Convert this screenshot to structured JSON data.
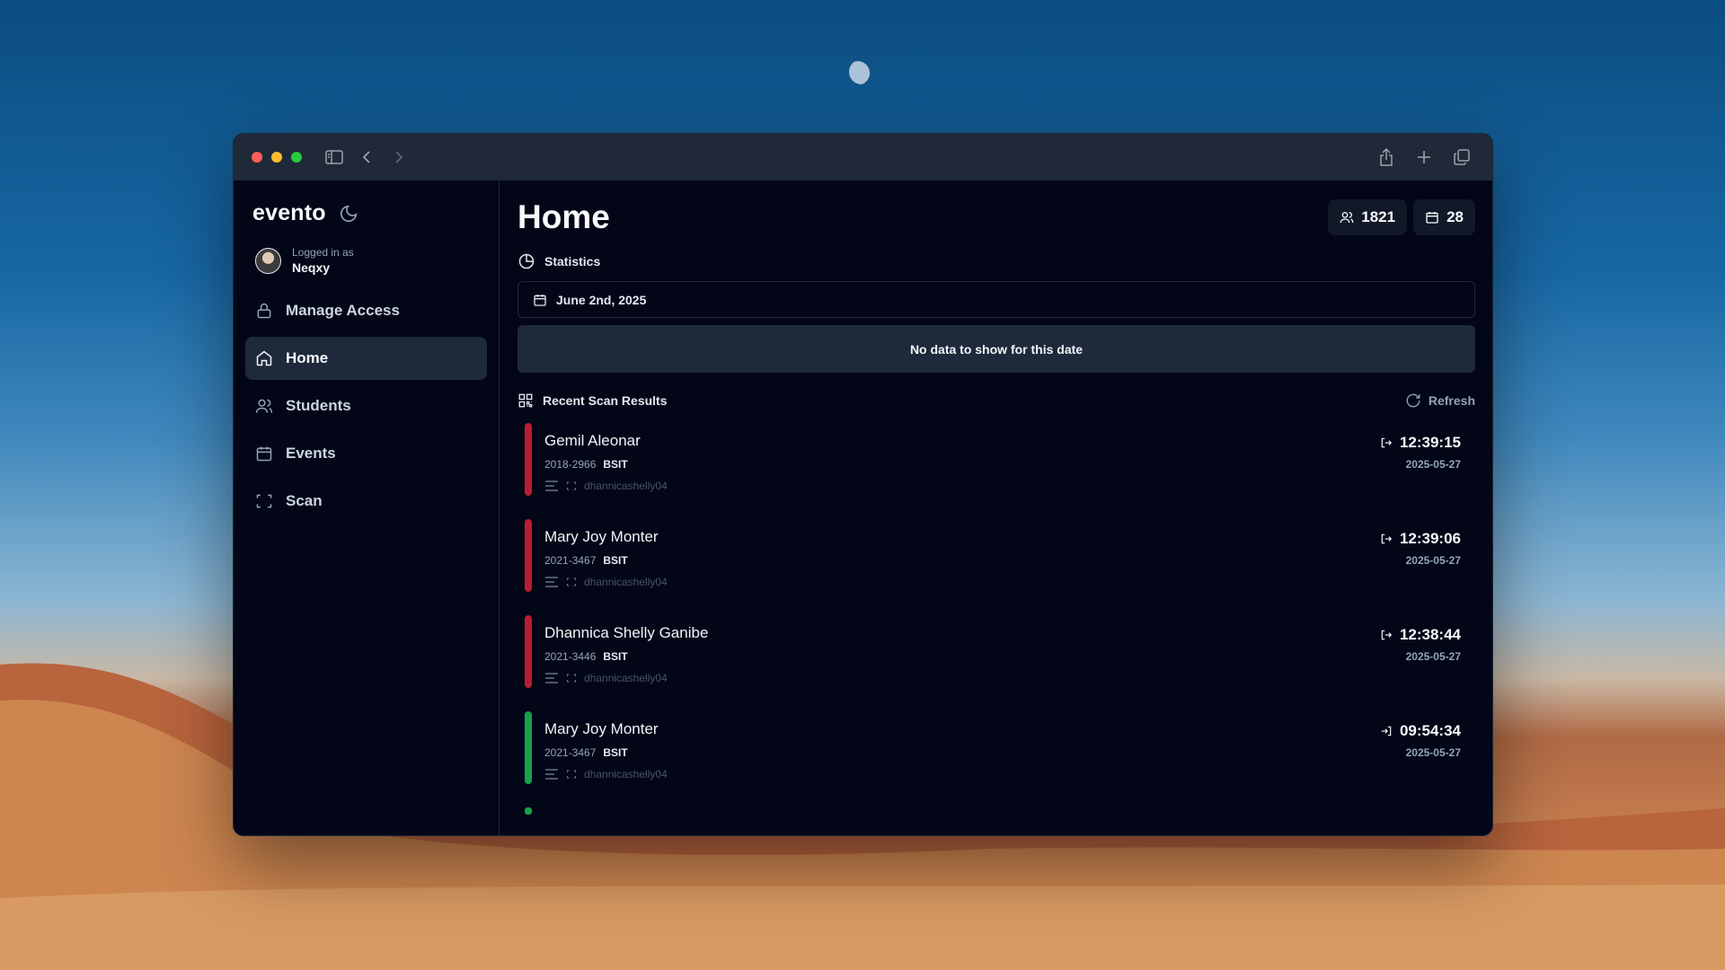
{
  "app": {
    "brand": "evento"
  },
  "user": {
    "logged_in_label": "Logged in as",
    "name": "Neqxy"
  },
  "sidebar": {
    "items": [
      {
        "label": "Manage Access",
        "icon": "lock-icon"
      },
      {
        "label": "Home",
        "icon": "home-icon",
        "active": true
      },
      {
        "label": "Students",
        "icon": "users-icon"
      },
      {
        "label": "Events",
        "icon": "calendar-icon"
      },
      {
        "label": "Scan",
        "icon": "scan-icon"
      }
    ]
  },
  "main": {
    "title": "Home",
    "counters": {
      "students": "1821",
      "events": "28"
    },
    "statistics": {
      "label": "Statistics",
      "date": "June 2nd, 2025",
      "empty_message": "No data to show for this date"
    },
    "results": {
      "label": "Recent Scan Results",
      "refresh_label": "Refresh",
      "rows": [
        {
          "name": "Gemil Aleonar",
          "id": "2018-2966",
          "course": "BSIT",
          "scanner": "dhannicashelly04",
          "time": "12:39:15",
          "date": "2025-05-27",
          "status": "out"
        },
        {
          "name": "Mary Joy Monter",
          "id": "2021-3467",
          "course": "BSIT",
          "scanner": "dhannicashelly04",
          "time": "12:39:06",
          "date": "2025-05-27",
          "status": "out"
        },
        {
          "name": "Dhannica Shelly Ganibe",
          "id": "2021-3446",
          "course": "BSIT",
          "scanner": "dhannicashelly04",
          "time": "12:38:44",
          "date": "2025-05-27",
          "status": "out"
        },
        {
          "name": "Mary Joy Monter",
          "id": "2021-3467",
          "course": "BSIT",
          "scanner": "dhannicashelly04",
          "time": "09:54:34",
          "date": "2025-05-27",
          "status": "in"
        }
      ]
    }
  },
  "colors": {
    "status_out": "#b91c35",
    "status_in": "#16a34a",
    "active_nav": "#1e293b"
  }
}
